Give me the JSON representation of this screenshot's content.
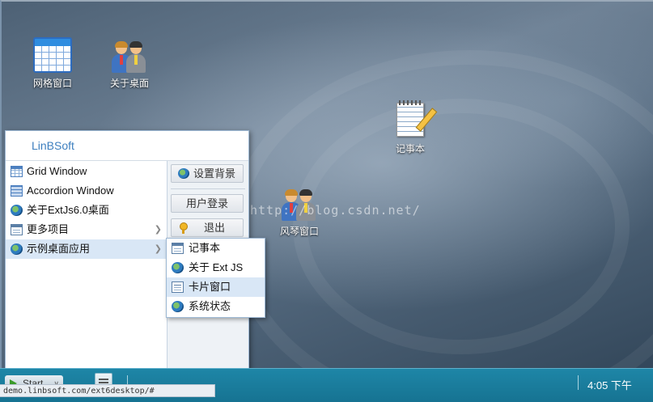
{
  "desktop": {
    "icons": {
      "grid": {
        "label": "网格窗口"
      },
      "about": {
        "label": "关于桌面"
      },
      "notepad": {
        "label": "记事本"
      },
      "piano": {
        "label": "风琴窗口"
      }
    },
    "watermark": "http://blog.csdn.net/"
  },
  "start_menu": {
    "title": "LinBSoft",
    "items": [
      {
        "label": "Grid Window",
        "icon": "grid-icon"
      },
      {
        "label": "Accordion Window",
        "icon": "accordion-icon"
      },
      {
        "label": "关于ExtJs6.0桌面",
        "icon": "gear-icon"
      },
      {
        "label": "更多项目",
        "icon": "window-icon",
        "has_submenu": true
      },
      {
        "label": "示例桌面应用",
        "icon": "gear-icon",
        "has_submenu": true,
        "active": true
      }
    ],
    "tools": {
      "settings_label": "设置背景",
      "login_label": "用户登录",
      "logout_label": "退出"
    }
  },
  "submenu": {
    "items": [
      {
        "label": "记事本",
        "icon": "window-icon"
      },
      {
        "label": "关于 Ext JS",
        "icon": "gear-icon"
      },
      {
        "label": "卡片窗口",
        "icon": "card-icon",
        "hover": true
      },
      {
        "label": "系统状态",
        "icon": "gear-icon"
      }
    ]
  },
  "taskbar": {
    "start_label": "Start",
    "clock": "4:05 下午"
  },
  "status_url": "demo.linbsoft.com/ext6desktop/#",
  "colors": {
    "taskbar": "#167392",
    "menu_title": "#3d7fbf",
    "active_item": "#d9e7f6"
  }
}
